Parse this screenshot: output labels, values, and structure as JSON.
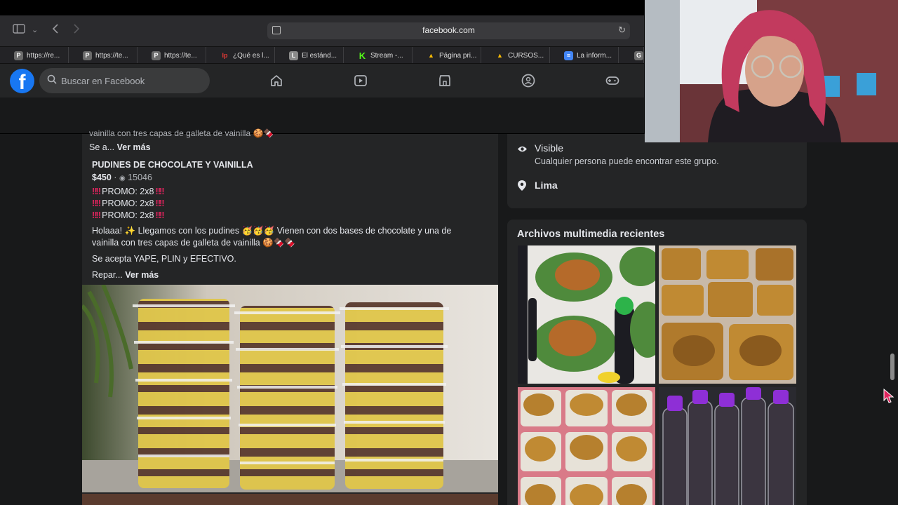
{
  "browser": {
    "url": "facebook.com",
    "tabs": [
      {
        "label": "https://re...",
        "favicon": "P",
        "color": "#6b6b6b"
      },
      {
        "label": "https://te...",
        "favicon": "P",
        "color": "#6b6b6b"
      },
      {
        "label": "https://te...",
        "favicon": "P",
        "color": "#6b6b6b"
      },
      {
        "label": "¿Qué es l...",
        "favicon": "lp",
        "color": "#c62828"
      },
      {
        "label": "El estánd...",
        "favicon": "L",
        "color": "#8a8a8a"
      },
      {
        "label": "Stream -...",
        "favicon": "K",
        "color": "#53fc18"
      },
      {
        "label": "Página pri...",
        "favicon": "▲",
        "color": "#1e8e3e"
      },
      {
        "label": "CURSOS...",
        "favicon": "▲",
        "color": "#1e8e3e"
      },
      {
        "label": "La inform...",
        "favicon": "≡",
        "color": "#4285f4"
      },
      {
        "label": "G",
        "favicon": "G",
        "color": "#6b6b6b"
      }
    ]
  },
  "facebook": {
    "logo": "f",
    "search_placeholder": "Buscar en Facebook"
  },
  "post": {
    "truncated_line": "vainilla con tres capas de galleta de vainilla 🍪🍫",
    "see_label_1": "Se a...",
    "more_label": "Ver más",
    "title": "PUDINES DE CHOCOLATE Y VAINILLA",
    "price": "$450",
    "separator": "·",
    "zip": "15046",
    "promos": [
      "PROMO: 2x8",
      "PROMO: 2x8",
      "PROMO: 2x8"
    ],
    "desc_line1": "Holaaa! ✨ Llegamos con los pudines 🥳🥳🥳 Vienen con dos bases de chocolate y una de",
    "desc_line2": "vainilla con tres capas de galleta de vainilla 🍪🍫🍫",
    "accept": "Se acepta YAPE, PLIN y EFECTIVO.",
    "see_label_2": "Repar...",
    "more_label_2": "Ver más"
  },
  "about": {
    "visible_title": "Visible",
    "visible_desc": "Cualquier persona puede encontrar este grupo.",
    "location": "Lima"
  },
  "media": {
    "heading": "Archivos multimedia recientes"
  },
  "colors": {
    "fb_blue": "#1877f2",
    "bg": "#18191a",
    "card": "#242526"
  }
}
